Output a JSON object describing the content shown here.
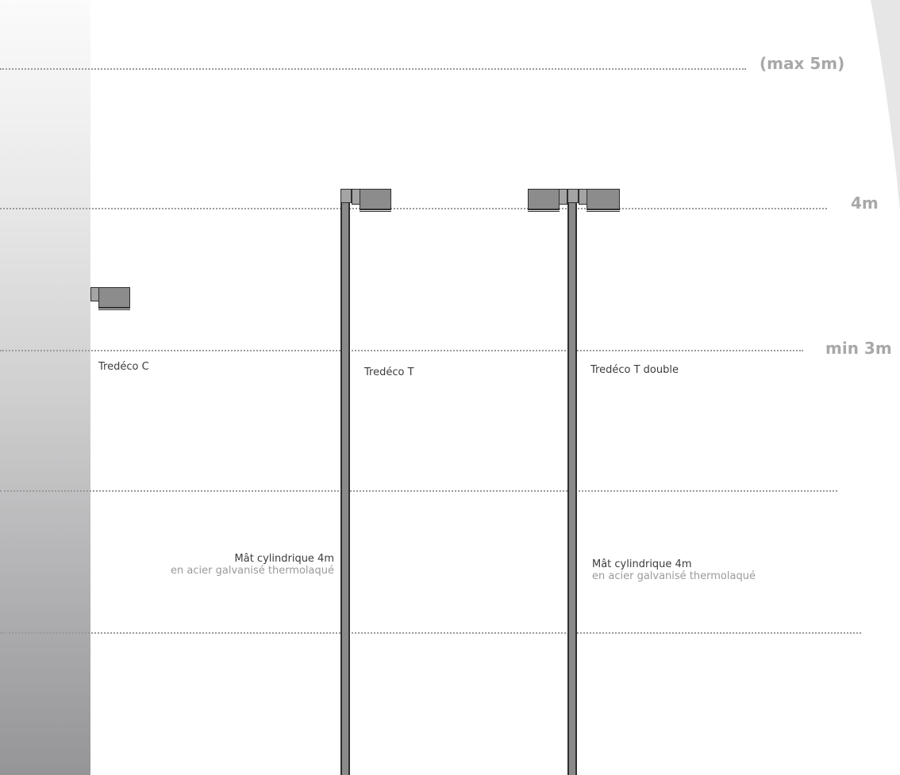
{
  "height_labels": {
    "max": "(max 5m)",
    "four": "4m",
    "min": "min 3m"
  },
  "products": {
    "c": "Tredéco C",
    "t": "Tredéco T",
    "t_double": "Tredéco T  double"
  },
  "mast": {
    "title": "Mât cylindrique 4m",
    "subtitle": "en acier galvanisé thermolaqué"
  },
  "colors": {
    "pole": "#8a8a8a",
    "outline": "#2f2f2f",
    "guide_line": "#9a9a9a",
    "height_label": "#a8a8a8"
  }
}
